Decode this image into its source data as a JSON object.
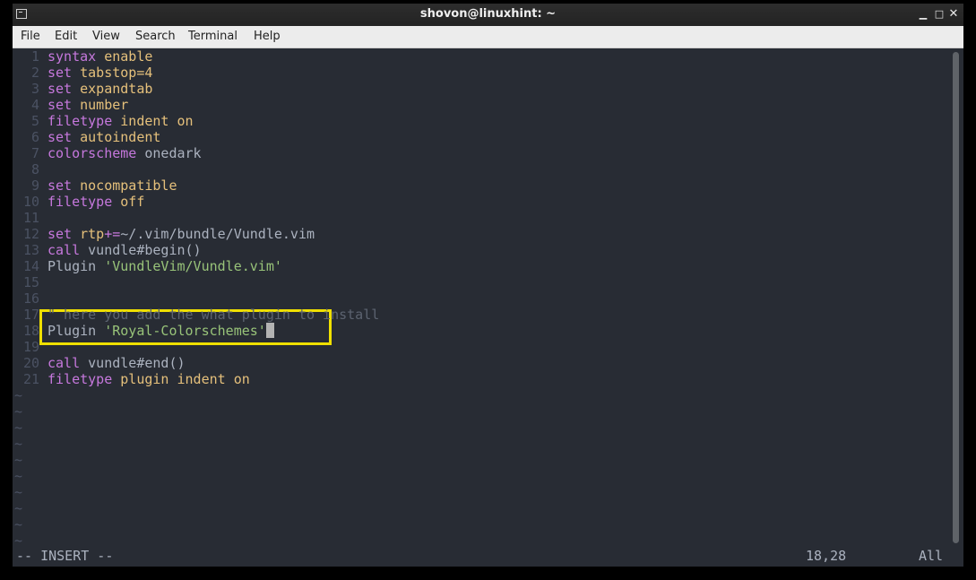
{
  "window": {
    "title": "shovon@linuxhint: ~"
  },
  "menubar": {
    "items": [
      "File",
      "Edit",
      "View",
      "Search",
      "Terminal",
      "Help"
    ]
  },
  "editor": {
    "lines": [
      {
        "n": "1",
        "segs": [
          [
            "kw",
            "syntax"
          ],
          [
            "pl",
            " "
          ],
          [
            "id",
            "enable"
          ]
        ]
      },
      {
        "n": "2",
        "segs": [
          [
            "kw",
            "set"
          ],
          [
            "pl",
            " "
          ],
          [
            "id",
            "tabstop=4"
          ]
        ]
      },
      {
        "n": "3",
        "segs": [
          [
            "kw",
            "set"
          ],
          [
            "pl",
            " "
          ],
          [
            "id",
            "expandtab"
          ]
        ]
      },
      {
        "n": "4",
        "segs": [
          [
            "kw",
            "set"
          ],
          [
            "pl",
            " "
          ],
          [
            "id",
            "number"
          ]
        ]
      },
      {
        "n": "5",
        "segs": [
          [
            "kw",
            "filetype"
          ],
          [
            "pl",
            " "
          ],
          [
            "id",
            "indent on"
          ]
        ]
      },
      {
        "n": "6",
        "segs": [
          [
            "kw",
            "set"
          ],
          [
            "pl",
            " "
          ],
          [
            "id",
            "autoindent"
          ]
        ]
      },
      {
        "n": "7",
        "segs": [
          [
            "kw",
            "colorscheme"
          ],
          [
            "pl",
            " onedark"
          ]
        ]
      },
      {
        "n": "8",
        "segs": []
      },
      {
        "n": "9",
        "segs": [
          [
            "kw",
            "set"
          ],
          [
            "pl",
            " "
          ],
          [
            "id",
            "nocompatible"
          ]
        ]
      },
      {
        "n": "10",
        "segs": [
          [
            "kw",
            "filetype"
          ],
          [
            "pl",
            " "
          ],
          [
            "id",
            "off"
          ]
        ]
      },
      {
        "n": "11",
        "segs": []
      },
      {
        "n": "12",
        "segs": [
          [
            "kw",
            "set"
          ],
          [
            "pl",
            " "
          ],
          [
            "id",
            "rtp"
          ],
          [
            "kw",
            "+="
          ],
          [
            "pl",
            "~/.vim/bundle/Vundle.vim"
          ]
        ]
      },
      {
        "n": "13",
        "segs": [
          [
            "kw",
            "call"
          ],
          [
            "pl",
            " vundle#begin()"
          ]
        ]
      },
      {
        "n": "14",
        "segs": [
          [
            "pl",
            "Plugin "
          ],
          [
            "str",
            "'VundleVim/Vundle.vim'"
          ]
        ]
      },
      {
        "n": "15",
        "segs": []
      },
      {
        "n": "16",
        "segs": []
      },
      {
        "n": "17",
        "segs": [
          [
            "cm",
            "\" here you add the what plugin to install"
          ]
        ]
      },
      {
        "n": "18",
        "segs": [
          [
            "pl",
            "Plugin "
          ],
          [
            "str",
            "'Royal-Colorschemes'"
          ]
        ],
        "cursor": true
      },
      {
        "n": "19",
        "segs": []
      },
      {
        "n": "20",
        "segs": [
          [
            "kw",
            "call"
          ],
          [
            "pl",
            " vundle#end()"
          ]
        ]
      },
      {
        "n": "21",
        "segs": [
          [
            "kw",
            "filetype"
          ],
          [
            "pl",
            " "
          ],
          [
            "id",
            "plugin indent on"
          ]
        ]
      }
    ],
    "tilde": "~",
    "tilde_count": 10
  },
  "statusline": {
    "mode": "-- INSERT --",
    "position": "18,28",
    "scroll": "All"
  },
  "colors": {
    "background": "#282c34",
    "keyword": "#c678dd",
    "identifier": "#e5c07b",
    "string": "#98c379",
    "comment": "#5c6370",
    "line_number": "#4b5263",
    "highlight_box": "#f0e000"
  }
}
